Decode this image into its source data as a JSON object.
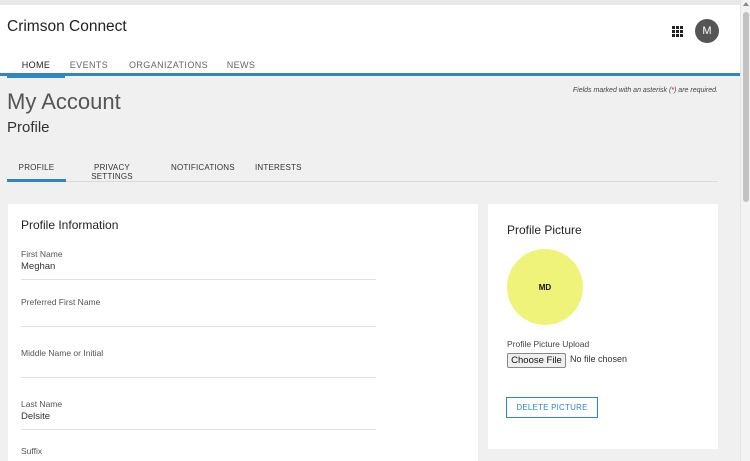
{
  "app": {
    "title": "Crimson Connect",
    "apps_icon": "apps-grid-icon",
    "avatar_initial": "M"
  },
  "main_nav": [
    {
      "label": "HOME",
      "active": true
    },
    {
      "label": "EVENTS",
      "active": false
    },
    {
      "label": "ORGANIZATIONS",
      "active": false
    },
    {
      "label": "NEWS",
      "active": false
    }
  ],
  "page": {
    "title": "My Account",
    "subtitle": "Profile",
    "required_note_prefix": "Fields marked with an asterisk (",
    "required_note_asterisk": "*",
    "required_note_suffix": ") are required."
  },
  "sub_tabs": [
    {
      "label": "PROFILE",
      "active": true
    },
    {
      "label": "PRIVACY SETTINGS",
      "active": false
    },
    {
      "label": "NOTIFICATIONS",
      "active": false
    },
    {
      "label": "INTERESTS",
      "active": false
    }
  ],
  "profile_info": {
    "title": "Profile Information",
    "fields": [
      {
        "label": "First Name",
        "value": "Meghan"
      },
      {
        "label": "Preferred First Name",
        "value": ""
      },
      {
        "label": "Middle Name or Initial",
        "value": ""
      },
      {
        "label": "Last Name",
        "value": "Delsite"
      },
      {
        "label": "Suffix",
        "value": ""
      }
    ]
  },
  "profile_picture": {
    "title": "Profile Picture",
    "initials": "MD",
    "circle_color": "#f0f379",
    "upload_label": "Profile Picture Upload",
    "choose_button": "Choose File",
    "file_status": "No file chosen",
    "delete_button": "DELETE PICTURE"
  },
  "colors": {
    "accent": "#2f86c1"
  }
}
